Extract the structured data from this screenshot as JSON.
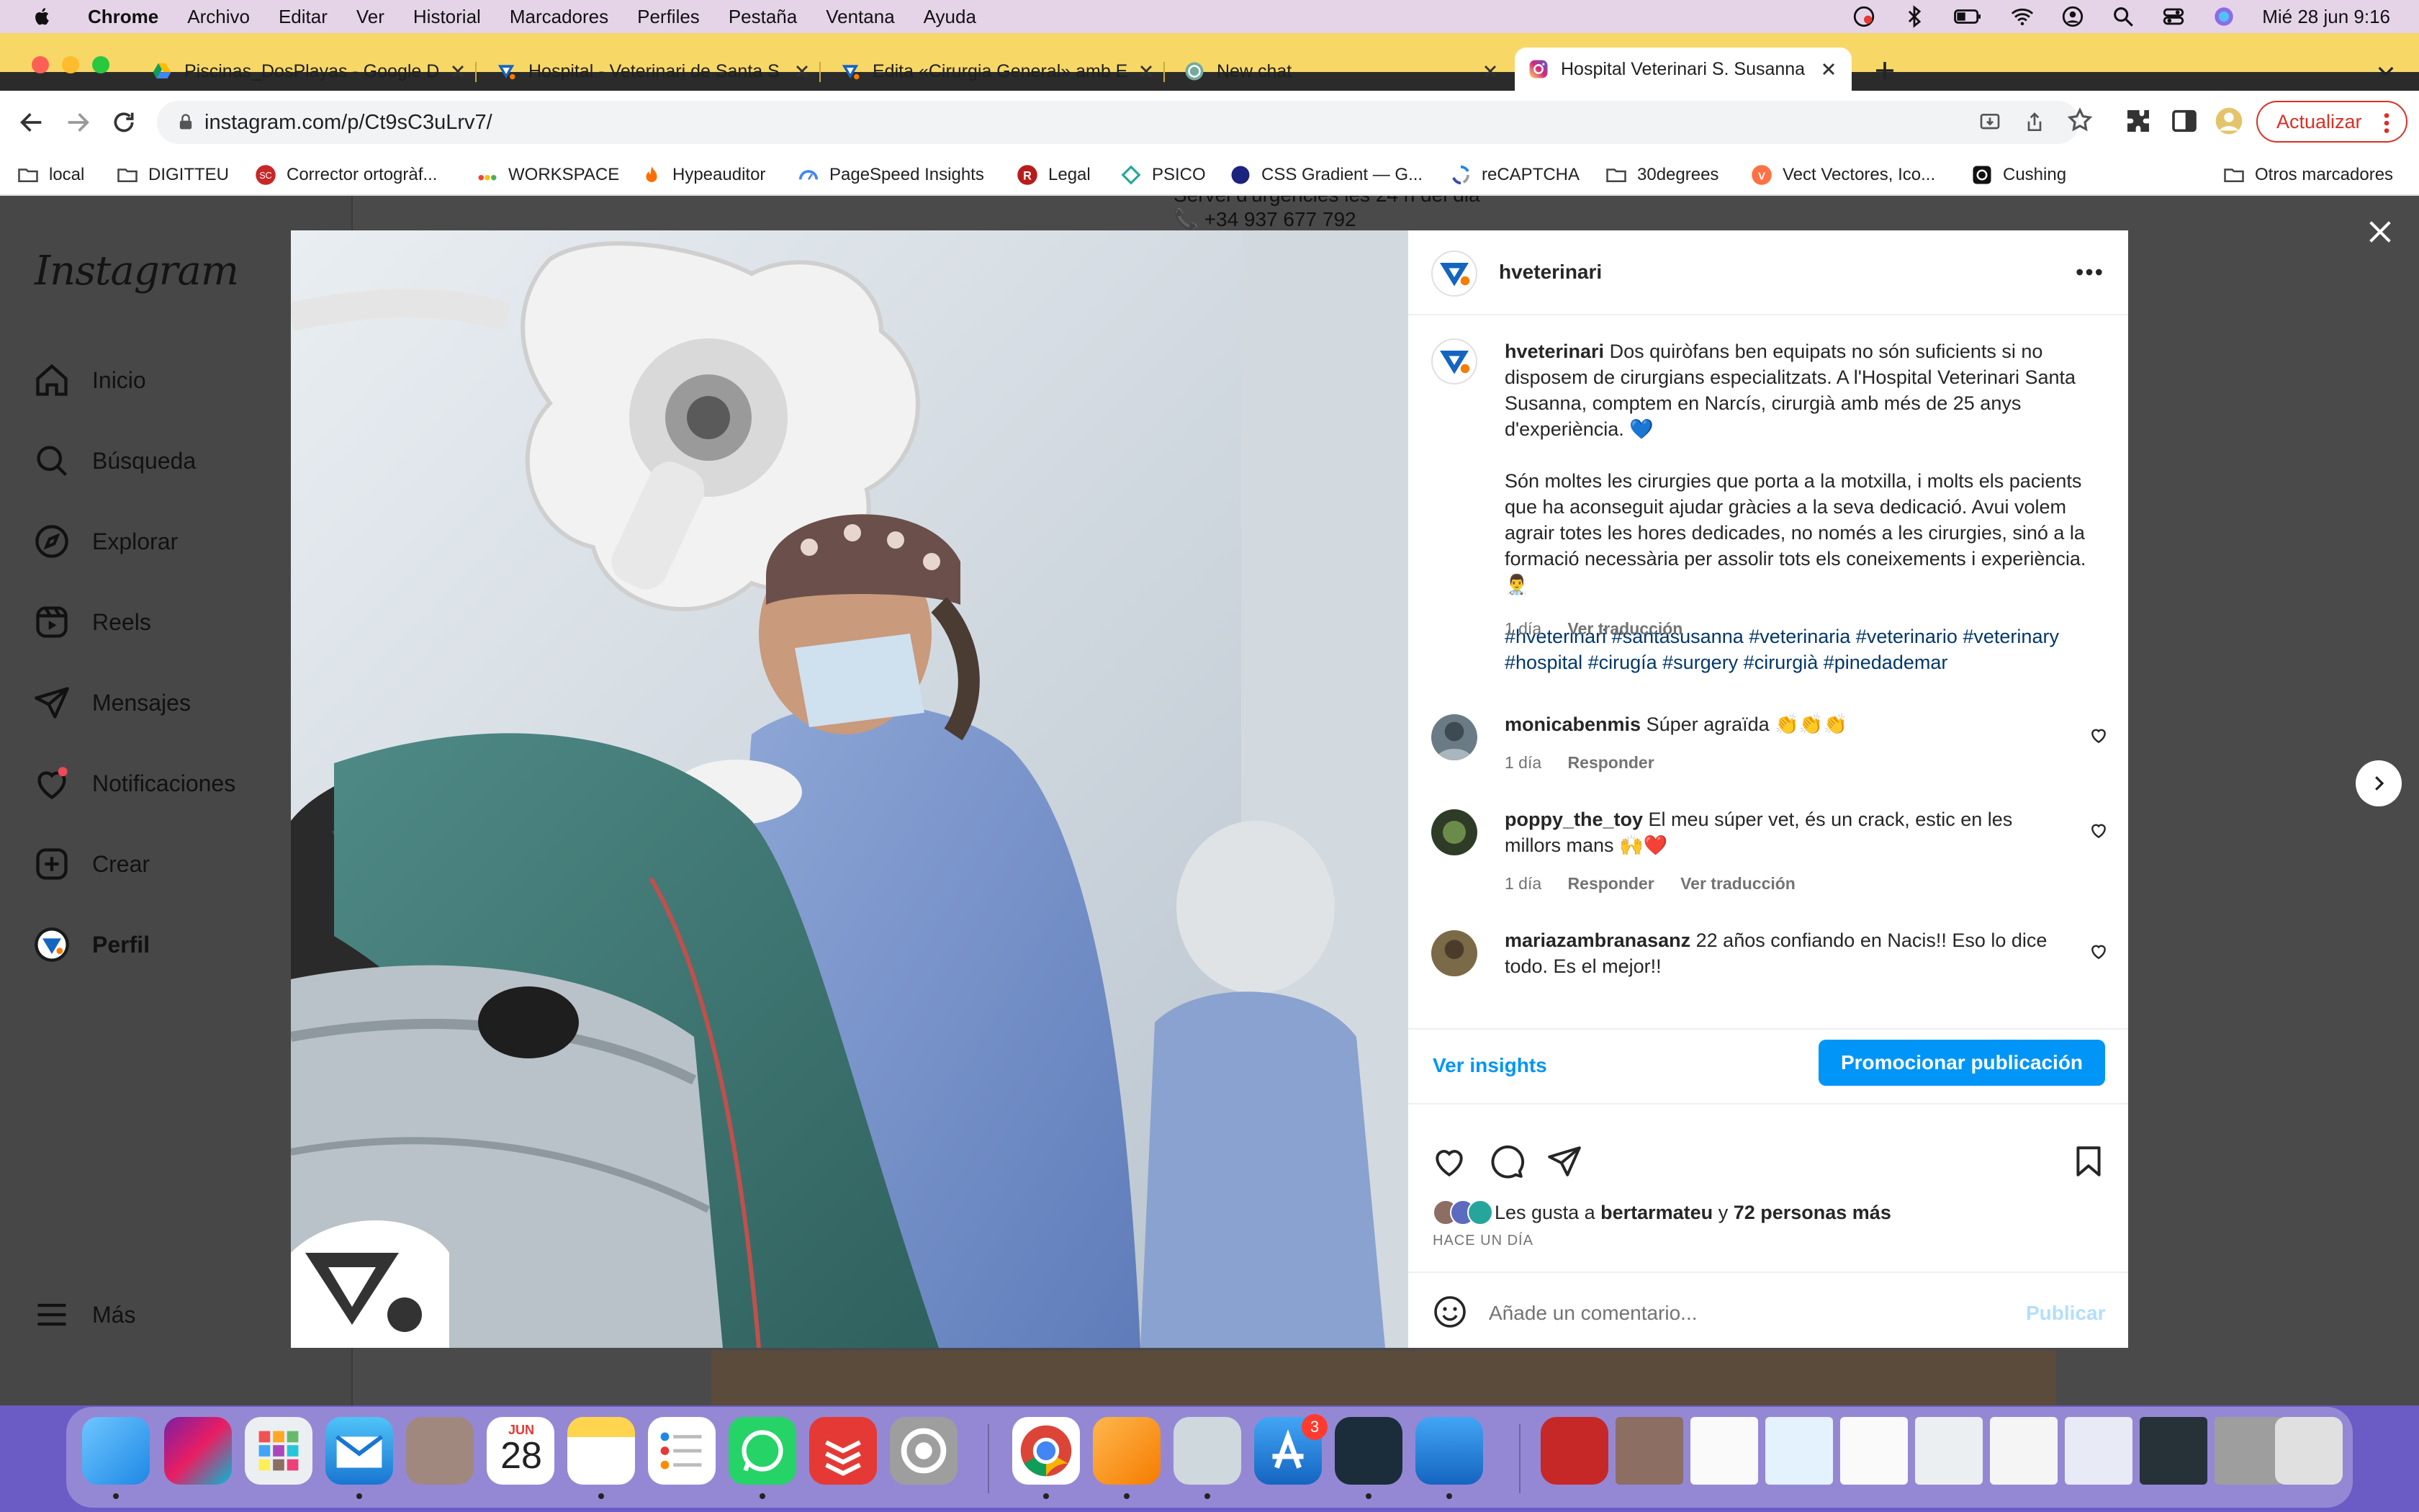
{
  "menubar": {
    "app": "Chrome",
    "items": [
      "Archivo",
      "Editar",
      "Ver",
      "Historial",
      "Marcadores",
      "Perfiles",
      "Pestaña",
      "Ventana",
      "Ayuda"
    ],
    "datetime": "Mié 28 jun  9:16"
  },
  "tabs": [
    {
      "label": "Piscinas_DosPlayas - Google D",
      "icon": "google-drive-icon"
    },
    {
      "label": "Hospital - Veterinari de Santa S",
      "icon": "hveterinari-icon"
    },
    {
      "label": "Edita «Cirurgia General» amb E",
      "icon": "hveterinari-icon"
    },
    {
      "label": "New chat",
      "icon": "chatgpt-icon"
    },
    {
      "label": "Hospital Veterinari S. Susanna",
      "icon": "instagram-icon",
      "active": true
    }
  ],
  "toolbar": {
    "url": "instagram.com/p/Ct9sC3uLrv7/",
    "update_label": "Actualizar"
  },
  "bookmarks": {
    "items": [
      "local",
      "DIGITTEU",
      "Corrector ortogràf...",
      "WORKSPACE",
      "Hypeauditor",
      "PageSpeed Insights",
      "Legal",
      "PSICO",
      "CSS Gradient — G...",
      "reCAPTCHA",
      "30degrees",
      "Vect Vectores, Ico...",
      "Cushing"
    ],
    "other": "Otros marcadores"
  },
  "background": {
    "line1": "Servei d'urgències les 24 h del dia",
    "phone": "📞 +34 937 677 792"
  },
  "instagram": {
    "logo": "Instagram",
    "nav": [
      "Inicio",
      "Búsqueda",
      "Explorar",
      "Reels",
      "Mensajes",
      "Notificaciones",
      "Crear",
      "Perfil"
    ],
    "more": "Más"
  },
  "post": {
    "username": "hveterinari",
    "caption": {
      "p1": "Dos quiròfans ben equipats no són suficients si no disposem de cirurgians especialitzats. A l'Hospital Veterinari Santa Susanna, comptem en Narcís, cirurgià amb més de 25 anys d'experiència. 💙",
      "p2": "Són moltes les cirurgies que porta a la motxilla, i molts els pacients que ha aconseguit ajudar gràcies a la seva dedicació. Avui volem agrair totes les hores dedicades, no només a les cirurgies, sinó a la formació necessària per assolir tots els coneixements i experiència. 👨‍⚕️",
      "tags": "#hveterinari #santasusanna #veterinaria #veterinario #veterinary #hospital #cirugía #surgery #cirurgià #pinedademar",
      "time": "1 día",
      "translate": "Ver traducción"
    },
    "comments": [
      {
        "user": "monicabenmis",
        "text": "Súper agraïda 👏👏👏",
        "time": "1 día",
        "reply": "Responder",
        "translate": ""
      },
      {
        "user": "poppy_the_toy",
        "text": "El meu súper vet, és un crack, estic en les millors mans 🙌❤️",
        "time": "1 día",
        "reply": "Responder",
        "translate": "Ver traducción"
      },
      {
        "user": "mariazambranasanz",
        "text": "22 años confiando en Nacis!! Eso lo dice todo. Es el mejor!!",
        "time": "",
        "reply": "",
        "translate": ""
      }
    ],
    "ver_insights": "Ver insights",
    "promote": "Promocionar publicación",
    "likes_prefix": "Les gusta a",
    "likes_user": "bertarmateu",
    "likes_and": "y",
    "likes_others": "72 personas más",
    "hace": "HACE UN DÍA",
    "comment_placeholder": "Añade un comentario...",
    "publish": "Publicar"
  },
  "dock": {
    "calendar_month": "JUN",
    "calendar_day": "28",
    "appstore_badge": "3"
  },
  "colors": {
    "menubar": "#e5d4e8",
    "tabstrip": "#f7d766",
    "ig_blue": "#0095f6",
    "dock": "#6a5cc4"
  }
}
